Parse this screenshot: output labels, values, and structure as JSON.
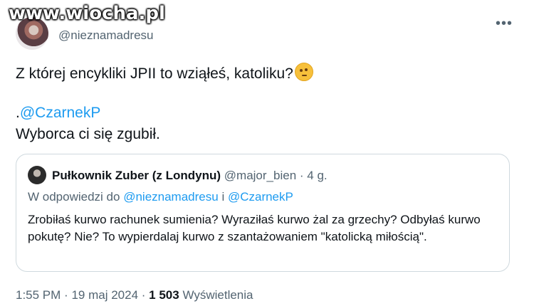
{
  "watermark": "www.wiocha.pl",
  "author": {
    "handle": "@nieznamadresu"
  },
  "more_icon": "more-dots-icon",
  "tweet": {
    "line1": "Z której encykliki JPII to wziąłeś, katoliku?",
    "emoji": "thinking-face-emoji",
    "mention_prefix": ".",
    "mention": "@CzarnekP",
    "line3": "Wyborca ci się zgubił."
  },
  "quote": {
    "name": "Pułkownik Zuber (z Londynu)",
    "handle": "@major_bien",
    "separator": "·",
    "age": "4 g.",
    "reply_prefix": "W odpowiedzi do",
    "reply_user1": "@nieznamadresu",
    "reply_and": "i",
    "reply_user2": "@CzarnekP",
    "body": "Zrobiłaś kurwo rachunek sumienia? Wyraziłaś kurwo żal za grzechy? Odbyłaś kurwo pokutę? Nie? To wypierdalaj kurwo z szantażowaniem \"katolicką miłością\"."
  },
  "footer": {
    "time": "1:55 PM",
    "dot1": "·",
    "date": "19 maj 2024",
    "dot2": "·",
    "views_count": "1 503",
    "views_label": "Wyświetlenia"
  }
}
